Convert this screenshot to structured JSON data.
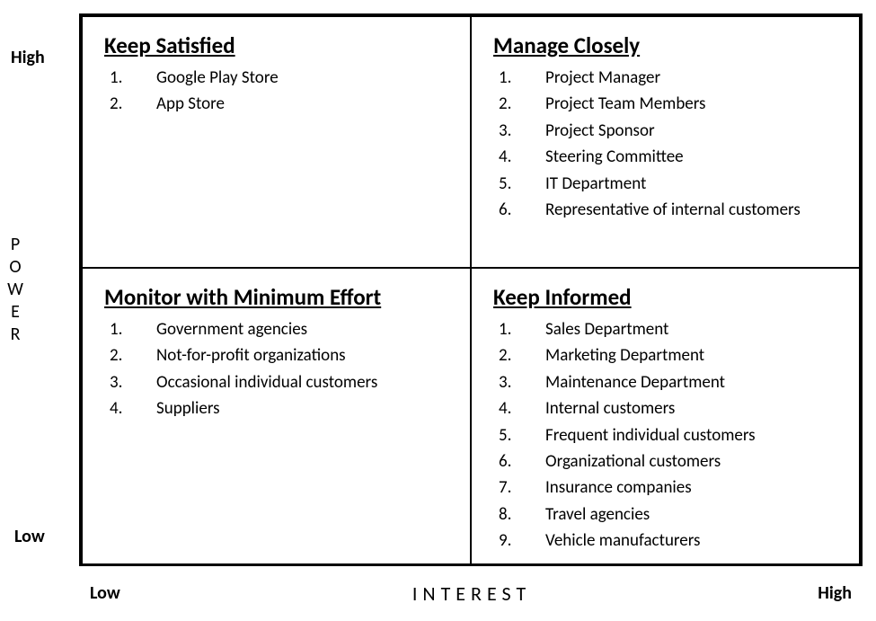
{
  "axes": {
    "y": {
      "label": "POWER",
      "high": "High",
      "low": "Low"
    },
    "x": {
      "label": "INTEREST",
      "low": "Low",
      "high": "High"
    }
  },
  "quadrants": {
    "top_left": {
      "title": "Keep Satisfied",
      "items": [
        "Google Play Store",
        "App Store"
      ]
    },
    "top_right": {
      "title": "Manage Closely",
      "items": [
        "Project Manager",
        "Project Team Members",
        "Project Sponsor",
        "Steering Committee",
        "IT Department",
        "Representative of internal customers"
      ]
    },
    "bottom_left": {
      "title": "Monitor with Minimum Effort",
      "items": [
        "Government agencies",
        "Not-for-profit organizations",
        "Occasional individual customers",
        "Suppliers"
      ]
    },
    "bottom_right": {
      "title": "Keep Informed",
      "items": [
        "Sales Department",
        "Marketing Department",
        "Maintenance Department",
        "Internal customers",
        "Frequent individual customers",
        "Organizational customers",
        "Insurance companies",
        "Travel agencies",
        "Vehicle manufacturers"
      ]
    }
  }
}
